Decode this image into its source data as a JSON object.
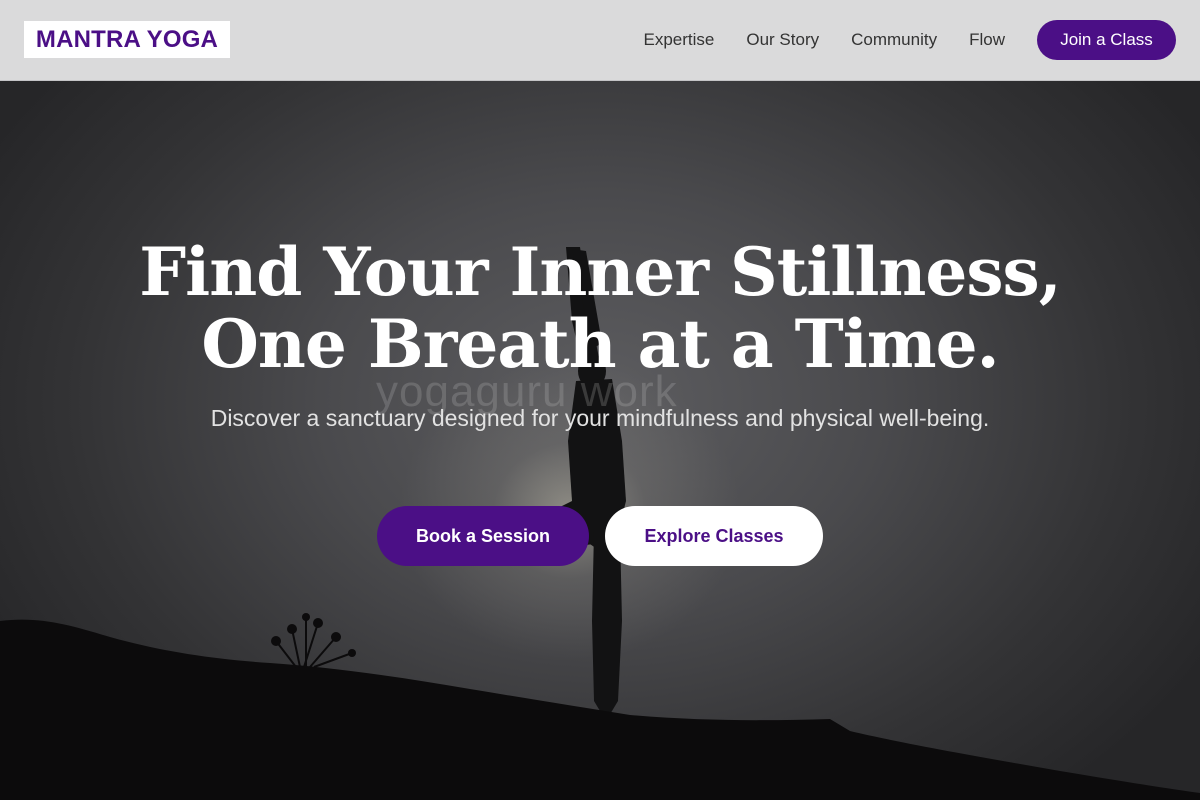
{
  "header": {
    "logo": "MANTRA YOGA",
    "nav": [
      "Expertise",
      "Our Story",
      "Community",
      "Flow"
    ],
    "cta": "Join a Class"
  },
  "hero": {
    "headline_line1": "Find Your Inner Stillness,",
    "headline_line2": "One Breath at a Time.",
    "subtext": "Discover a sanctuary designed for your mindfulness and physical well-being.",
    "primary_button": "Book a Session",
    "secondary_button": "Explore Classes",
    "watermark": "yogaguru work"
  },
  "colors": {
    "brand_purple": "#4b0f86",
    "header_bg": "#dadadb",
    "white": "#ffffff"
  }
}
